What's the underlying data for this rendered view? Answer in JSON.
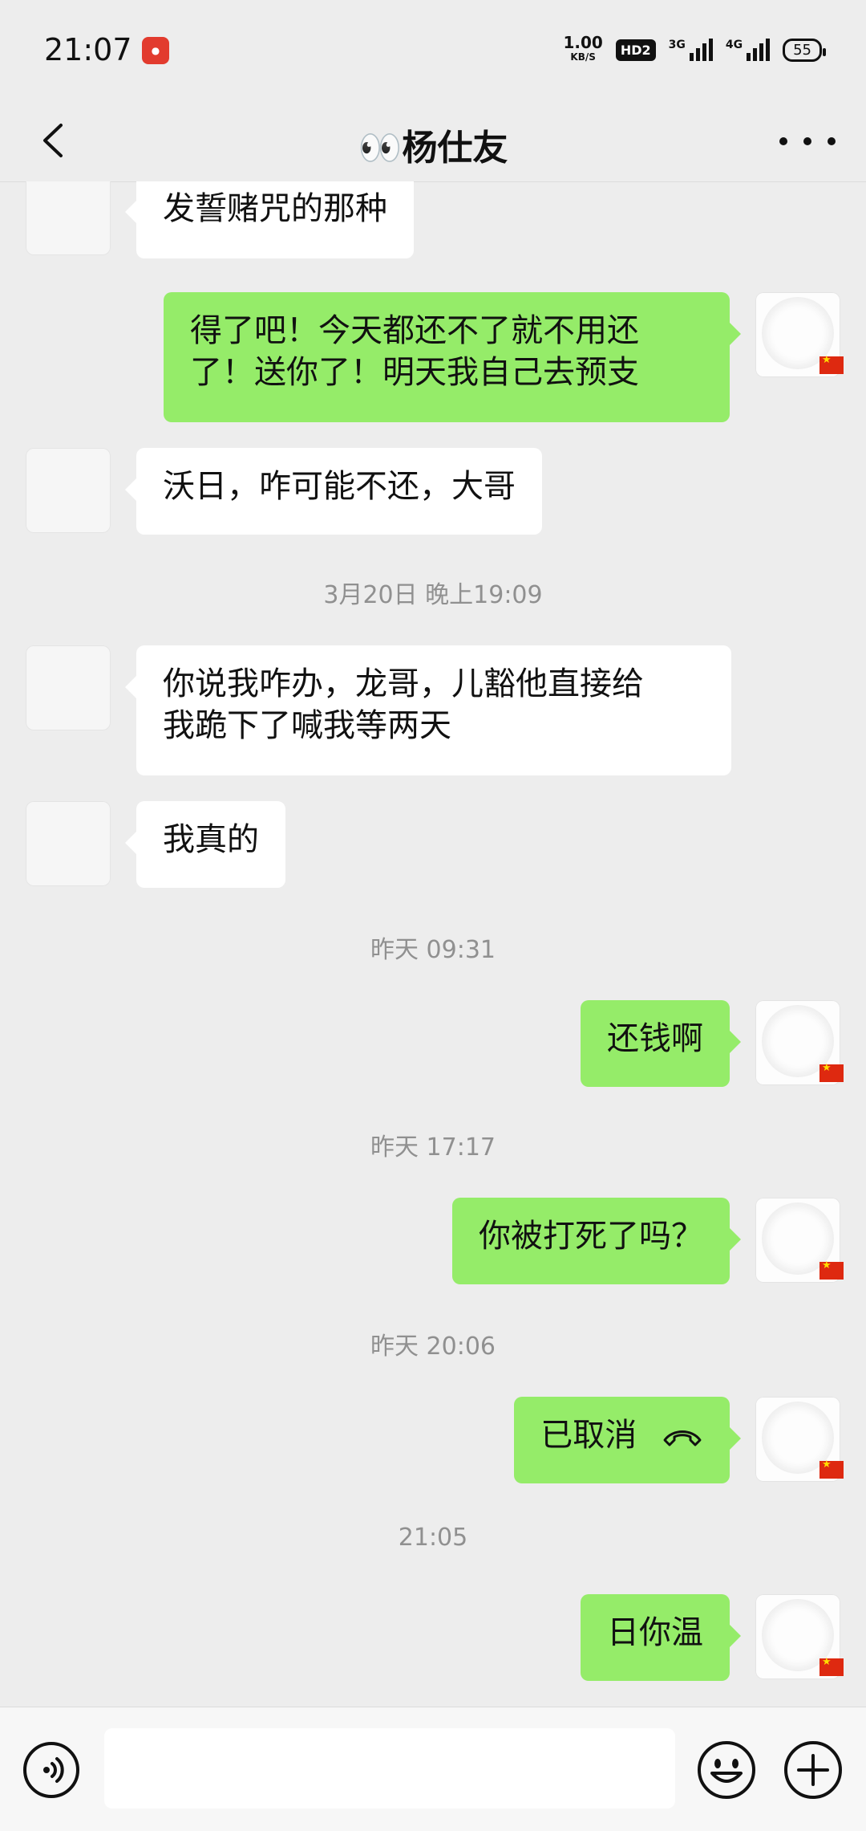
{
  "status_bar": {
    "time": "21:07",
    "net_speed": "1.00",
    "net_unit": "KB/S",
    "hd_label": "HD2",
    "signal1_label": "3G",
    "signal2_label": "4G",
    "battery": "55"
  },
  "header": {
    "title": "👀杨仕友",
    "back_icon": "back-chevron-icon",
    "more_icon": "more-dots-icon"
  },
  "messages": [
    {
      "side": "in",
      "text": "发誓赌咒的那种"
    },
    {
      "side": "out",
      "lines": [
        "得了吧！今天都还不了就不用还",
        "了！送你了！明天我自己去预支"
      ]
    },
    {
      "side": "in",
      "text": "沃日，咋可能不还，大哥"
    },
    {
      "type": "time",
      "text": "3月20日 晚上19:09"
    },
    {
      "side": "in",
      "lines": [
        "你说我咋办，龙哥，儿豁他直接给",
        "我跪下了喊我等两天"
      ]
    },
    {
      "side": "in",
      "text": "我真的"
    },
    {
      "type": "time",
      "text": "昨天 09:31"
    },
    {
      "side": "out",
      "text": "还钱啊"
    },
    {
      "type": "time",
      "text": "昨天 17:17"
    },
    {
      "side": "out",
      "text": "你被打死了吗？"
    },
    {
      "type": "time",
      "text": "昨天 20:06"
    },
    {
      "side": "out",
      "text": "已取消",
      "icon": "phone-hangup-icon"
    },
    {
      "type": "time",
      "text": "21:05"
    },
    {
      "side": "out",
      "text": "日你温"
    }
  ],
  "bottom_bar": {
    "voice_icon": "voice-input-icon",
    "emoji_icon": "emoji-icon",
    "plus_icon": "plus-icon"
  },
  "colors": {
    "background": "#ededed",
    "incoming_bubble": "#ffffff",
    "outgoing_bubble": "#95ec69",
    "timestamp_text": "#909090"
  }
}
